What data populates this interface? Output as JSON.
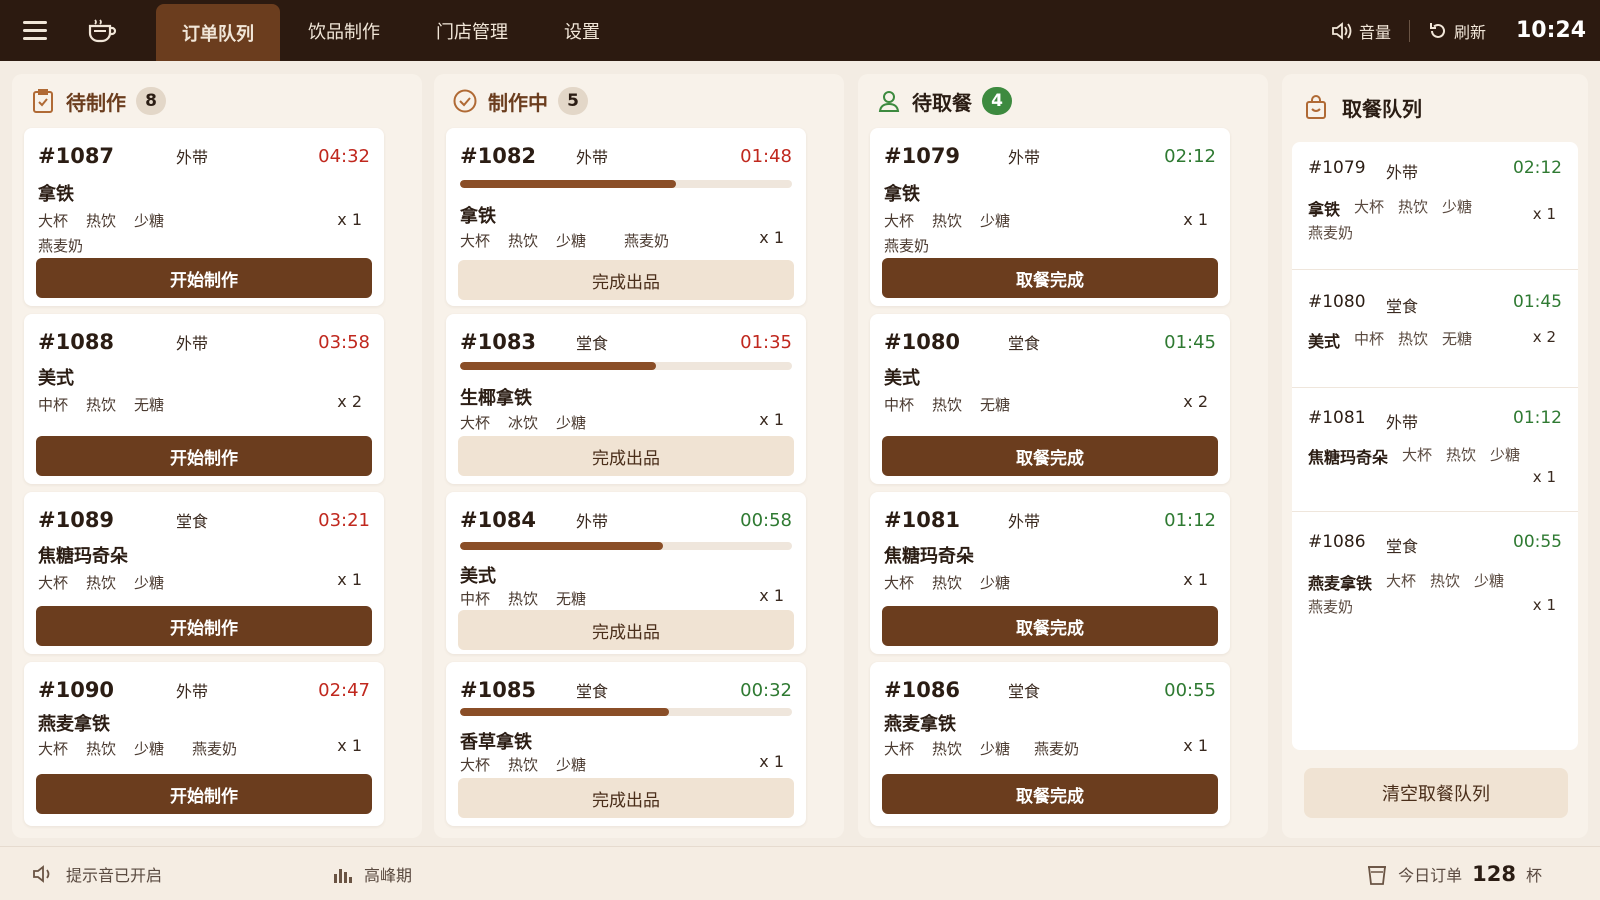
{
  "nav": {
    "tabs": [
      {
        "label": "订单队列",
        "active": true
      },
      {
        "label": "饮品制作",
        "active": false
      },
      {
        "label": "门店管理",
        "active": false
      },
      {
        "label": "设置",
        "active": false
      }
    ],
    "volume_label": "音量",
    "refresh_label": "刷新",
    "clock": "10:24"
  },
  "columns": {
    "pending": {
      "title": "待制作",
      "count": "8",
      "orders": [
        {
          "no": "#1087",
          "type": "外带",
          "time": "04:32",
          "drink": "拿铁",
          "opts": [
            "大杯",
            "热饮",
            "少糖"
          ],
          "extra": "燕麦奶",
          "qty": "x 1",
          "action": "开始制作"
        },
        {
          "no": "#1088",
          "type": "外带",
          "time": "03:58",
          "drink": "美式",
          "opts": [
            "中杯",
            "热饮",
            "无糖"
          ],
          "extra": "",
          "qty": "x 2",
          "action": "开始制作"
        },
        {
          "no": "#1089",
          "type": "堂食",
          "time": "03:21",
          "drink": "焦糖玛奇朵",
          "opts": [
            "大杯",
            "热饮",
            "少糖"
          ],
          "extra": "",
          "qty": "x 1",
          "action": "开始制作"
        },
        {
          "no": "#1090",
          "type": "外带",
          "time": "02:47",
          "drink": "燕麦拿铁",
          "opts": [
            "大杯",
            "热饮",
            "少糖",
            "燕麦奶"
          ],
          "extra": "",
          "qty": "x 1",
          "action": "开始制作"
        }
      ]
    },
    "making": {
      "title": "制作中",
      "count": "5",
      "orders": [
        {
          "no": "#1082",
          "type": "外带",
          "time": "01:48",
          "time_color": "red",
          "progress": 0.65,
          "drink": "拿铁",
          "opts": [
            "大杯",
            "热饮",
            "少糖",
            "燕麦奶"
          ],
          "qty": "x 1",
          "action": "完成出品"
        },
        {
          "no": "#1083",
          "type": "堂食",
          "time": "01:35",
          "time_color": "red",
          "progress": 0.59,
          "drink": "生椰拿铁",
          "opts": [
            "大杯",
            "冰饮",
            "少糖"
          ],
          "qty": "x 1",
          "action": "完成出品"
        },
        {
          "no": "#1084",
          "type": "外带",
          "time": "00:58",
          "time_color": "green",
          "progress": 0.61,
          "drink": "美式",
          "opts": [
            "中杯",
            "热饮",
            "无糖"
          ],
          "qty": "x 1",
          "action": "完成出品"
        },
        {
          "no": "#1085",
          "type": "堂食",
          "time": "00:32",
          "time_color": "green",
          "progress": 0.63,
          "drink": "香草拿铁",
          "opts": [
            "大杯",
            "热饮",
            "少糖"
          ],
          "qty": "x 1",
          "action": "完成出品"
        }
      ]
    },
    "pickup": {
      "title": "待取餐",
      "count": "4",
      "orders": [
        {
          "no": "#1079",
          "type": "外带",
          "time": "02:12",
          "drink": "拿铁",
          "opts": [
            "大杯",
            "热饮",
            "少糖"
          ],
          "extra": "燕麦奶",
          "qty": "x 1",
          "action": "取餐完成"
        },
        {
          "no": "#1080",
          "type": "堂食",
          "time": "01:45",
          "drink": "美式",
          "opts": [
            "中杯",
            "热饮",
            "无糖"
          ],
          "extra": "",
          "qty": "x 2",
          "action": "取餐完成"
        },
        {
          "no": "#1081",
          "type": "外带",
          "time": "01:12",
          "drink": "焦糖玛奇朵",
          "opts": [
            "大杯",
            "热饮",
            "少糖"
          ],
          "extra": "",
          "qty": "x 1",
          "action": "取餐完成"
        },
        {
          "no": "#1086",
          "type": "堂食",
          "time": "00:55",
          "drink": "燕麦拿铁",
          "opts": [
            "大杯",
            "热饮",
            "少糖",
            "燕麦奶"
          ],
          "extra": "",
          "qty": "x 1",
          "action": "取餐完成"
        }
      ]
    }
  },
  "queue": {
    "title": "取餐队列",
    "items": [
      {
        "no": "#1079",
        "type": "外带",
        "time": "02:12",
        "drink": "拿铁",
        "opts": [
          "大杯",
          "热饮",
          "少糖"
        ],
        "extra": "燕麦奶",
        "qty": "x 1"
      },
      {
        "no": "#1080",
        "type": "堂食",
        "time": "01:45",
        "drink": "美式",
        "opts": [
          "中杯",
          "热饮",
          "无糖"
        ],
        "extra": "",
        "qty": "x 2"
      },
      {
        "no": "#1081",
        "type": "外带",
        "time": "01:12",
        "drink": "焦糖玛奇朵",
        "opts": [
          "大杯",
          "热饮",
          "少糖"
        ],
        "extra": "",
        "qty": "x 1"
      },
      {
        "no": "#1086",
        "type": "堂食",
        "time": "00:55",
        "drink": "燕麦拿铁",
        "opts": [
          "大杯",
          "热饮",
          "少糖"
        ],
        "extra": "燕麦奶",
        "qty": "x 1"
      }
    ],
    "clear_label": "清空取餐队列"
  },
  "footer": {
    "sound_status": "提示音已开启",
    "peak_label": "高峰期",
    "today_label": "今日订单",
    "today_count": "128",
    "today_unit": "杯"
  },
  "colors": {
    "topbar": "#2c1a10",
    "accent": "#6b3d1e",
    "time_red": "#c0281e",
    "time_green": "#2f7a32",
    "pickup_badge": "#3d8a3f"
  }
}
